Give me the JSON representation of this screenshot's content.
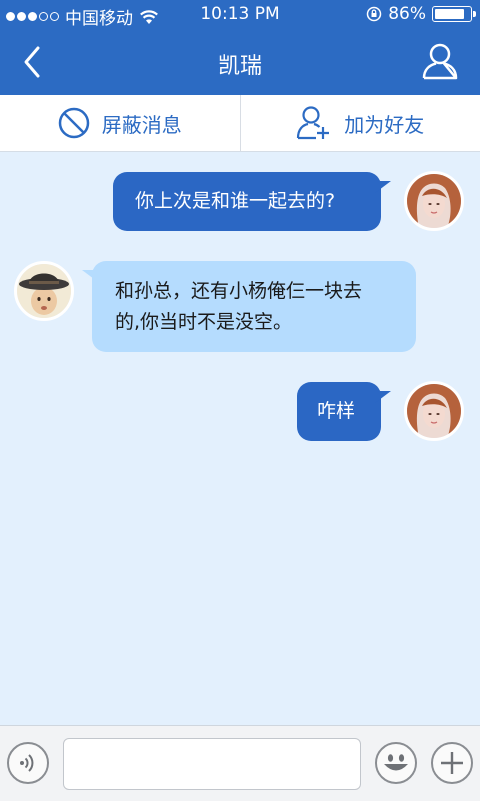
{
  "status_bar": {
    "carrier": "中国移动",
    "time": "10:13 PM",
    "battery": "86%",
    "battery_level": 0.86
  },
  "nav": {
    "title": "凯瑞"
  },
  "actions": {
    "block_label": "屏蔽消息",
    "add_friend_label": "加为好友"
  },
  "messages": [
    {
      "direction": "out",
      "text": "你上次是和谁一起去的?"
    },
    {
      "direction": "in",
      "text_line1": "和孙总，还有小杨俺仨一块去",
      "text_line2": "的,你当时不是没空。"
    },
    {
      "direction": "out",
      "text": "咋样"
    }
  ],
  "input": {
    "value": "",
    "placeholder": ""
  },
  "colors": {
    "header": "#2c6bc3",
    "background": "#e3f0fd",
    "outgoing_bubble": "#2b67c4",
    "incoming_bubble": "#b5dcfe"
  },
  "icons": [
    "wifi-icon",
    "lock-rotation-icon",
    "back-arrow-icon",
    "profile-icon",
    "block-icon",
    "add-friend-icon",
    "voice-icon",
    "emoji-icon",
    "plus-icon"
  ]
}
